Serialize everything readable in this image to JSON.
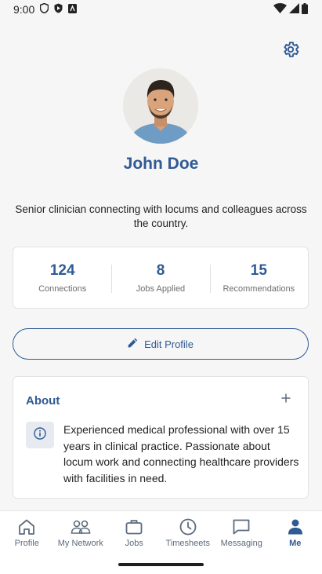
{
  "status_bar": {
    "time": "9:00",
    "icons": [
      "shield-icon",
      "play-protect-icon",
      "sim-icon",
      "wifi-icon",
      "cellular-icon",
      "battery-icon"
    ]
  },
  "header": {
    "settings_icon": "gear-icon"
  },
  "profile": {
    "name": "John Doe",
    "bio": "Senior clinician connecting with locums and colleagues across the country."
  },
  "stats": [
    {
      "value": "124",
      "label": "Connections"
    },
    {
      "value": "8",
      "label": "Jobs Applied"
    },
    {
      "value": "15",
      "label": "Recommendations"
    }
  ],
  "edit_profile": {
    "label": "Edit Profile",
    "icon": "pencil-icon"
  },
  "about": {
    "title": "About",
    "text": "Experienced medical professional with over 15 years in clinical practice. Passionate about locum work and connecting healthcare providers with facilities in need."
  },
  "nav": {
    "items": [
      {
        "label": "Profile",
        "icon": "home-icon"
      },
      {
        "label": "My Network",
        "icon": "people-icon"
      },
      {
        "label": "Jobs",
        "icon": "briefcase-icon"
      },
      {
        "label": "Timesheets",
        "icon": "clock-icon"
      },
      {
        "label": "Messaging",
        "icon": "chat-icon"
      },
      {
        "label": "Me",
        "icon": "person-icon",
        "active": true
      }
    ]
  },
  "colors": {
    "accent": "#2f5a94",
    "nav_inactive": "#5d6b7d",
    "background": "#f6f6f6"
  }
}
